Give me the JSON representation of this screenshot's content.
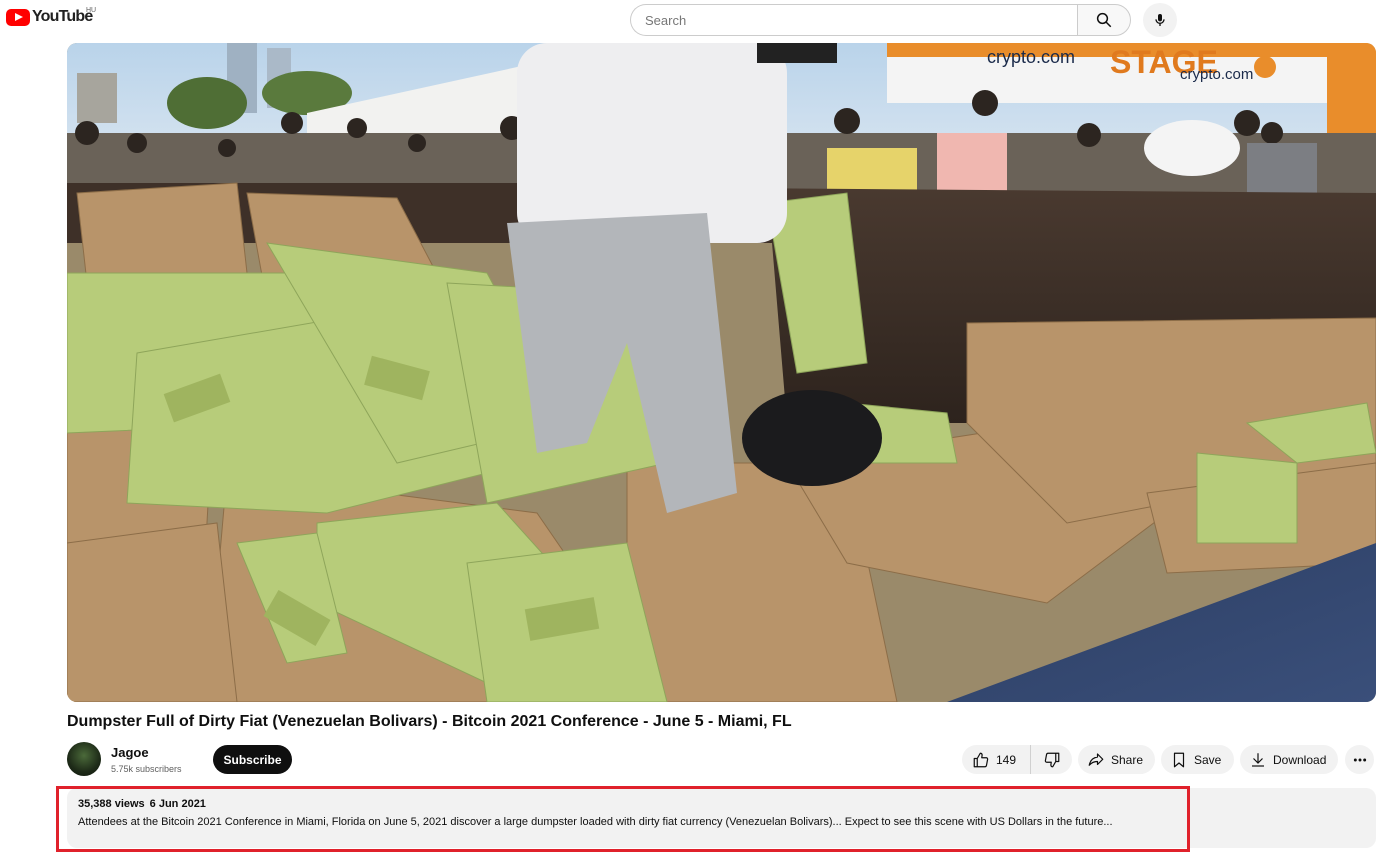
{
  "masthead": {
    "logo_text": "YouTube",
    "country_code": "HU",
    "search_placeholder": "Search"
  },
  "video": {
    "title": "Dumpster Full of Dirty Fiat (Venezuelan Bolivars) - Bitcoin 2021 Conference - June 5 - Miami, FL",
    "thumbnail_signs": [
      "crypto.com",
      "STAGE",
      "crypto.com"
    ]
  },
  "owner": {
    "channel_name": "Jagoe",
    "subscribers": "5.75k subscribers",
    "subscribe_label": "Subscribe"
  },
  "actions": {
    "like_count": "149",
    "share_label": "Share",
    "save_label": "Save",
    "download_label": "Download"
  },
  "description": {
    "views": "35,388 views",
    "date": "6 Jun 2021",
    "text": "Attendees at the Bitcoin 2021 Conference in Miami, Florida on June 5, 2021 discover a large dumpster loaded with dirty fiat currency (Venezuelan Bolivars)... Expect to see this scene with US Dollars in the future..."
  },
  "colors": {
    "brand_red": "#ff0000",
    "highlight_red": "#e0212b",
    "subscribe_bg": "#0f0f0f",
    "pill_bg": "#f2f2f2"
  },
  "icons": [
    "youtube-logo-icon",
    "search-icon",
    "microphone-icon",
    "thumbs-up-icon",
    "thumbs-down-icon",
    "share-arrow-icon",
    "bookmark-icon",
    "download-icon",
    "more-dots-icon"
  ]
}
